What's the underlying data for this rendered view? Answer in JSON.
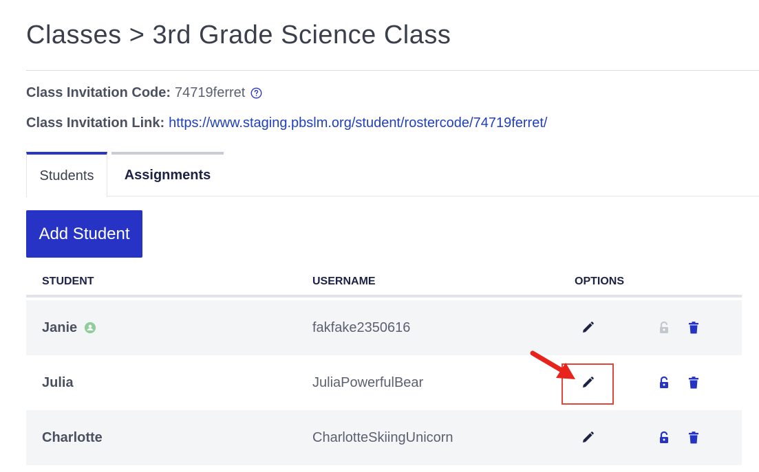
{
  "header": {
    "title": "Classes > 3rd Grade Science Class"
  },
  "class_info": {
    "code_label": "Class Invitation Code:",
    "code_value": "74719ferret",
    "link_label": "Class Invitation Link:",
    "link_value": "https://www.staging.pbslm.org/student/rostercode/74719ferret/"
  },
  "tabs": [
    {
      "label": "Students",
      "active": true
    },
    {
      "label": "Assignments",
      "active": false
    }
  ],
  "actions": {
    "add_student_label": "Add Student"
  },
  "table": {
    "columns": [
      "STUDENT",
      "USERNAME",
      "OPTIONS"
    ],
    "rows": [
      {
        "name": "Janie",
        "username": "fakfake2350616",
        "has_status_icon": true,
        "unlock_enabled": false
      },
      {
        "name": "Julia",
        "username": "JuliaPowerfulBear",
        "has_status_icon": false,
        "unlock_enabled": true
      },
      {
        "name": "Charlotte",
        "username": "CharlotteSkiingUnicorn",
        "has_status_icon": false,
        "unlock_enabled": true
      }
    ]
  },
  "colors": {
    "accent": "#2633c4",
    "link": "#1f3fbf",
    "heading_dark": "#1c2145",
    "annotation_red": "#e0453a",
    "status_green": "#8fce9b",
    "disabled_gray": "#c3c7cf"
  },
  "icons": {
    "help": "help-circle-icon",
    "edit": "pencil-icon",
    "unlock": "unlock-icon",
    "delete": "trash-icon",
    "status": "user-status-icon"
  }
}
